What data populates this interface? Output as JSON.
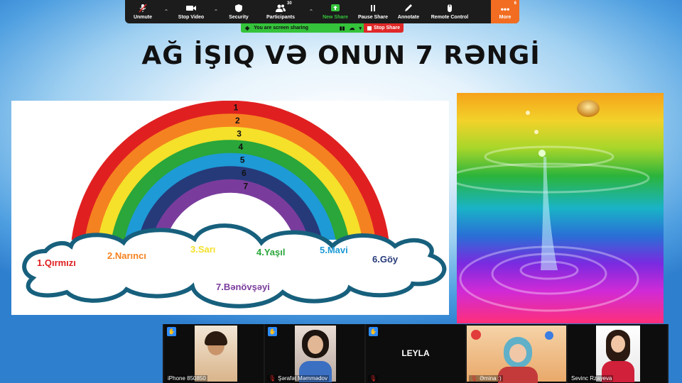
{
  "toolbar": {
    "buttons": [
      {
        "label": "Unmute"
      },
      {
        "label": "Stop Video"
      },
      {
        "label": "Security"
      },
      {
        "label": "Participants",
        "count": "30"
      },
      {
        "label": "New Share"
      },
      {
        "label": "Pause Share"
      },
      {
        "label": "Annotate"
      },
      {
        "label": "Remote Control"
      },
      {
        "label": "More",
        "count": "6"
      }
    ]
  },
  "sharebar": {
    "status": "You are screen sharing",
    "stop": "Stop Share"
  },
  "slide": {
    "title": "AĞ İŞIQ VƏ ONUN 7 RƏNGİ",
    "arc_numbers": [
      "1",
      "2",
      "3",
      "4",
      "5",
      "6",
      "7"
    ],
    "colors": [
      {
        "label": "1.Qırmızı",
        "hex": "#e02020"
      },
      {
        "label": "2.Narıncı",
        "hex": "#f58220"
      },
      {
        "label": "3.Sarı",
        "hex": "#f5e02a"
      },
      {
        "label": "4.Yaşıl",
        "hex": "#2aa63a"
      },
      {
        "label": "5.Mavi",
        "hex": "#1e9ad6"
      },
      {
        "label": "6.Göy",
        "hex": "#263a7a"
      },
      {
        "label": "7.Bənövşəyi",
        "hex": "#7a3c9c"
      }
    ]
  },
  "gallery": {
    "participants": [
      {
        "name": "iPhone 850850",
        "hand": true
      },
      {
        "name": "Şərafət Məmmədov",
        "hand": true,
        "muted": true
      },
      {
        "name": "",
        "display": "LEYLA",
        "hand": true,
        "muted": true
      },
      {
        "name": "Əmina :)",
        "muted": true
      },
      {
        "name": "Sevinc Rzayeva"
      }
    ]
  }
}
